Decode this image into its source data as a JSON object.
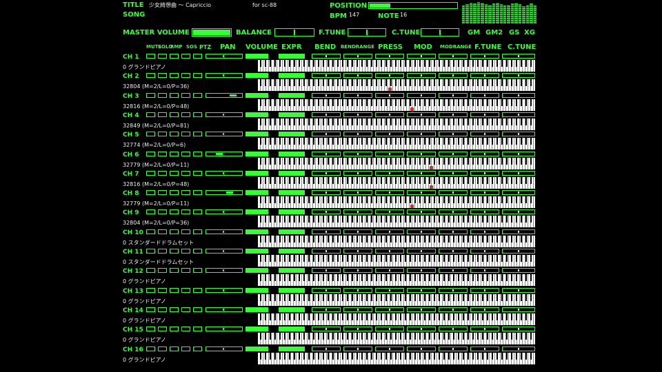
{
  "title_label": "TITLE",
  "song_label": "SONG",
  "title": "少女綺想曲 〜 Capriccio",
  "system": "for sc-88",
  "position_label": "POSITION",
  "bpm_label": "BPM",
  "bpm": "147",
  "note_label": "NOTE",
  "note": "16",
  "controls": {
    "master_volume": "MASTER VOLUME",
    "balance": "BALANCE",
    "f_tune": "F.TUNE",
    "c_tune": "C.TUNE",
    "gm": "GM",
    "gm2": "GM2",
    "gs": "GS",
    "xg": "XG"
  },
  "headers": {
    "mute": "MUTE",
    "solo": "SOLO",
    "rmp": "RMP",
    "sos": "SOS",
    "ptz": "PTZ",
    "pan": "PAN",
    "volume": "VOLUME",
    "expr": "EXPR",
    "bend": "BEND",
    "bend_range": "BENDRANGE",
    "press": "PRESS",
    "mod": "MOD",
    "mod_range": "MODRANGE",
    "f_tune": "F.TUNE",
    "c_tune": "C.TUNE"
  },
  "colors": {
    "accent": "#33ff33",
    "note_on": "#dd2222",
    "background": "#000000"
  },
  "channels": [
    {
      "ch": "CH 1",
      "program": "0 グランドピアノ",
      "volume": 0.62,
      "pan": 0.5,
      "notes": []
    },
    {
      "ch": "CH 2",
      "program": "32804 (M=2/L=0/P=36)",
      "volume": 0.62,
      "pan": 0.5,
      "notes": [
        0.47
      ]
    },
    {
      "ch": "CH 3",
      "program": "32816 (M=2/L=0/P=48)",
      "volume": 0.62,
      "pan": 0.7,
      "notes": [
        0.55
      ]
    },
    {
      "ch": "CH 4",
      "program": "32849 (M=2/L=0/P=81)",
      "volume": 0.62,
      "pan": 0.5,
      "notes": []
    },
    {
      "ch": "CH 5",
      "program": "32774 (M=2/L=0/P=6)",
      "volume": 0.62,
      "pan": 0.5,
      "notes": []
    },
    {
      "ch": "CH 6",
      "program": "32779 (M=2/L=0/P=11)",
      "volume": 0.62,
      "pan": 0.3,
      "notes": [
        0.62
      ]
    },
    {
      "ch": "CH 7",
      "program": "32816 (M=2/L=0/P=48)",
      "volume": 0.62,
      "pan": 0.5,
      "notes": [
        0.62
      ]
    },
    {
      "ch": "CH 8",
      "program": "32779 (M=2/L=0/P=11)",
      "volume": 0.62,
      "pan": 0.6,
      "notes": [
        0.55
      ]
    },
    {
      "ch": "CH 9",
      "program": "32804 (M=2/L=0/P=36)",
      "volume": 0.62,
      "pan": 0.5,
      "notes": []
    },
    {
      "ch": "CH 10",
      "program": "0 スタンダードドラムセット",
      "volume": 0.62,
      "pan": 0.5,
      "notes": []
    },
    {
      "ch": "CH 11",
      "program": "0 スタンダードドラムセット",
      "volume": 0.62,
      "pan": 0.5,
      "notes": []
    },
    {
      "ch": "CH 12",
      "program": "0 グランドピアノ",
      "volume": 0.62,
      "pan": 0.5,
      "notes": []
    },
    {
      "ch": "CH 13",
      "program": "0 グランドピアノ",
      "volume": 0.62,
      "pan": 0.5,
      "notes": []
    },
    {
      "ch": "CH 14",
      "program": "0 グランドピアノ",
      "volume": 0.62,
      "pan": 0.5,
      "notes": []
    },
    {
      "ch": "CH 15",
      "program": "0 グランドピアノ",
      "volume": 0.62,
      "pan": 0.5,
      "notes": []
    },
    {
      "ch": "CH 16",
      "program": "0 グランドピアノ",
      "volume": 0.62,
      "pan": 0.5,
      "notes": []
    }
  ]
}
